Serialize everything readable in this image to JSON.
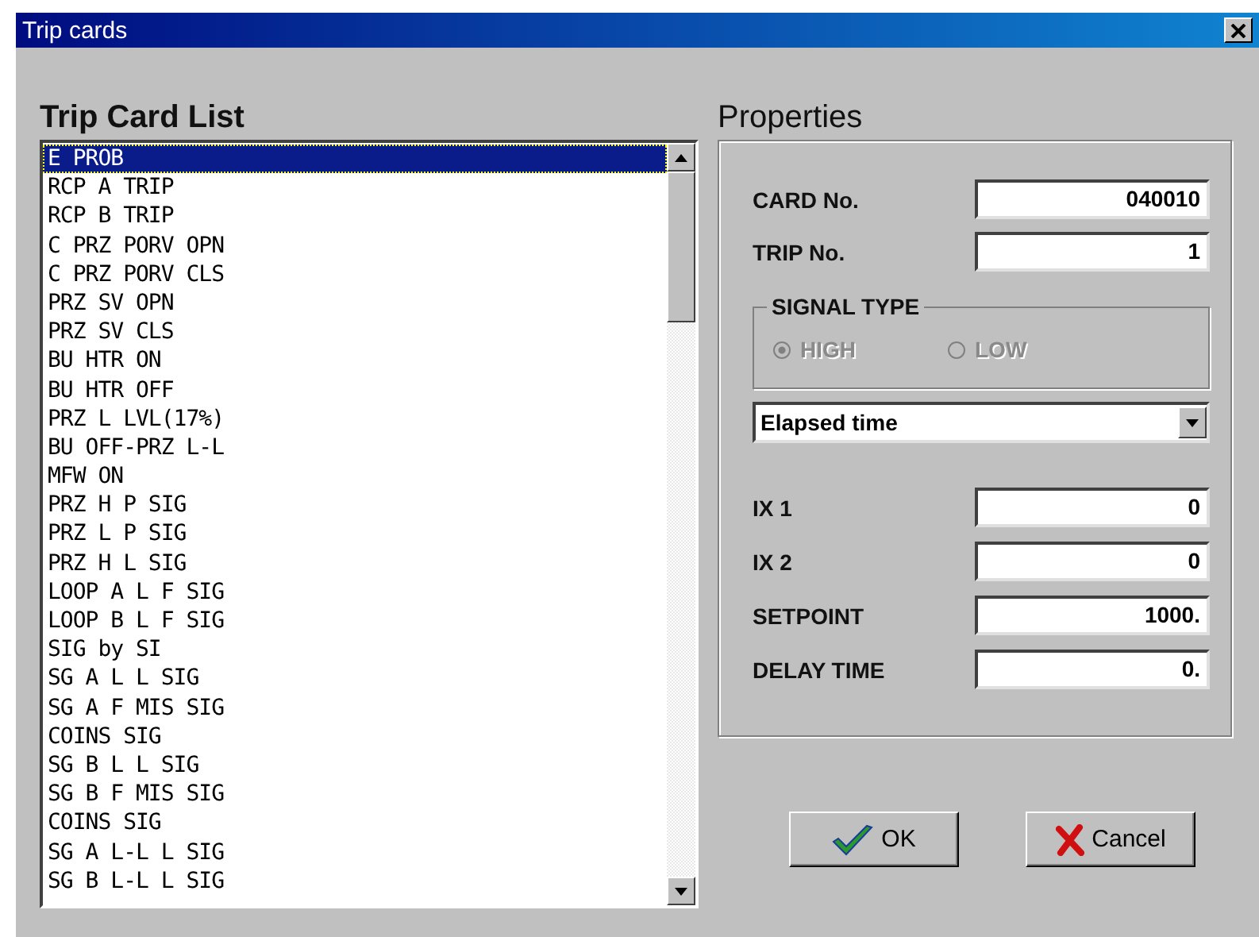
{
  "window": {
    "title": "Trip cards"
  },
  "trip_card_list": {
    "heading": "Trip Card List",
    "items": [
      {
        "label": "E PROB",
        "selected": true
      },
      {
        "label": "RCP A TRIP",
        "selected": false
      },
      {
        "label": "RCP B TRIP",
        "selected": false
      },
      {
        "label": "C PRZ PORV OPN",
        "selected": false
      },
      {
        "label": "C PRZ PORV CLS",
        "selected": false
      },
      {
        "label": "PRZ SV OPN",
        "selected": false
      },
      {
        "label": "PRZ SV CLS",
        "selected": false
      },
      {
        "label": "BU HTR ON",
        "selected": false
      },
      {
        "label": "BU HTR OFF",
        "selected": false
      },
      {
        "label": "PRZ L LVL(17%)",
        "selected": false
      },
      {
        "label": "BU OFF-PRZ L-L",
        "selected": false
      },
      {
        "label": "MFW ON",
        "selected": false
      },
      {
        "label": "PRZ H P SIG",
        "selected": false
      },
      {
        "label": "PRZ L P SIG",
        "selected": false
      },
      {
        "label": "PRZ H L SIG",
        "selected": false
      },
      {
        "label": "LOOP A L F SIG",
        "selected": false
      },
      {
        "label": "LOOP B L F SIG",
        "selected": false
      },
      {
        "label": "SIG by SI",
        "selected": false
      },
      {
        "label": "SG A L L SIG",
        "selected": false
      },
      {
        "label": "SG A F MIS SIG",
        "selected": false
      },
      {
        "label": "COINS SIG",
        "selected": false
      },
      {
        "label": "SG B L L SIG",
        "selected": false
      },
      {
        "label": "SG B F MIS SIG",
        "selected": false
      },
      {
        "label": "COINS SIG",
        "selected": false
      },
      {
        "label": "SG A L-L L SIG",
        "selected": false
      },
      {
        "label": "SG B L-L L SIG",
        "selected": false
      }
    ]
  },
  "properties": {
    "heading": "Properties",
    "top_fields": [
      {
        "label": "CARD No.",
        "value": "040010"
      },
      {
        "label": "TRIP No.",
        "value": "1"
      }
    ],
    "signal_type": {
      "label": "SIGNAL TYPE",
      "disabled": true,
      "options": [
        {
          "label": "HIGH",
          "selected": true
        },
        {
          "label": "LOW",
          "selected": false
        }
      ]
    },
    "dropdown": {
      "value": "Elapsed time"
    },
    "bottom_fields": [
      {
        "label": "IX 1",
        "value": "0"
      },
      {
        "label": "IX 2",
        "value": "0"
      },
      {
        "label": "SETPOINT",
        "value": "1000."
      },
      {
        "label": "DELAY TIME",
        "value": "0."
      }
    ]
  },
  "buttons": [
    {
      "kind": "ok",
      "label": "OK"
    },
    {
      "kind": "cancel",
      "label": "Cancel"
    }
  ]
}
